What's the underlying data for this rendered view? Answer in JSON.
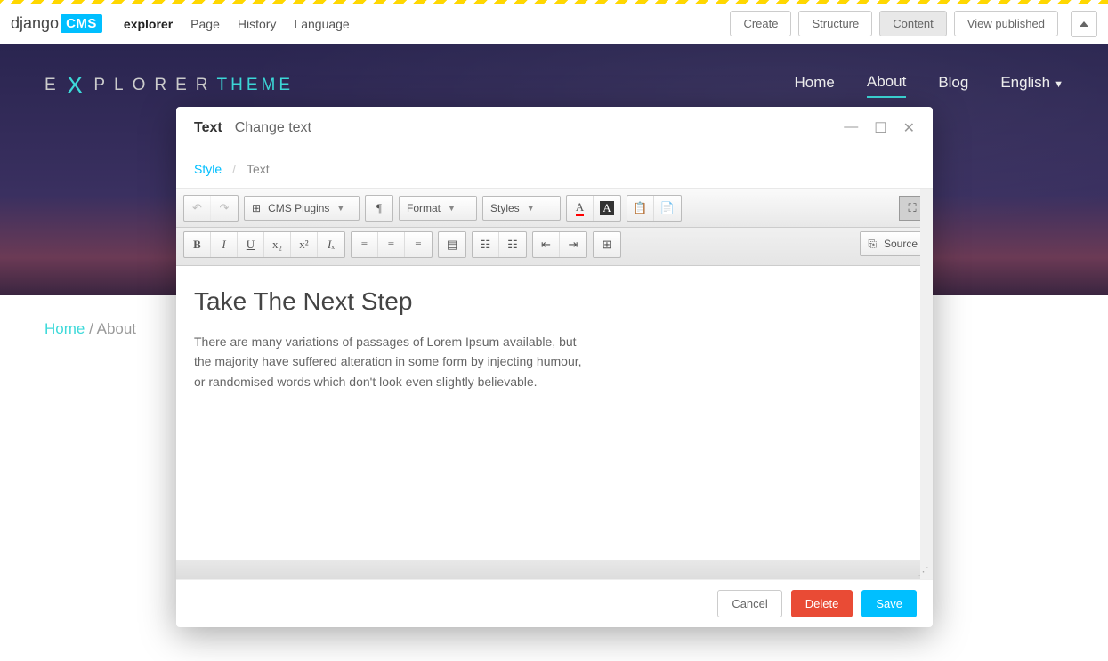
{
  "toolbar": {
    "logo_text": "django",
    "logo_badge": "CMS",
    "items": [
      "explorer",
      "Page",
      "History",
      "Language"
    ],
    "buttons": {
      "create": "Create",
      "structure": "Structure",
      "content": "Content",
      "view": "View published"
    }
  },
  "site_nav": {
    "logo_left": "E",
    "logo_x": "X",
    "logo_mid": "PLORER",
    "logo_right": "THEME",
    "links": [
      "Home",
      "About",
      "Blog",
      "English"
    ]
  },
  "breadcrumb": {
    "home": "Home",
    "current": "About"
  },
  "modal": {
    "title_bold": "Text",
    "title": "Change text",
    "tabs": {
      "style": "Style",
      "text": "Text"
    },
    "toolbar": {
      "cms_plugins": "CMS Plugins",
      "format": "Format",
      "styles": "Styles",
      "source": "Source",
      "color_a": "A",
      "bg_a": "A"
    },
    "content": {
      "heading": "Take The Next Step",
      "body": "There are many variations of passages of Lorem Ipsum available, but the majority have suffered alteration in some form by injecting humour, or randomised words which don't look even slightly believable."
    },
    "footer": {
      "cancel": "Cancel",
      "delete": "Delete",
      "save": "Save"
    }
  }
}
